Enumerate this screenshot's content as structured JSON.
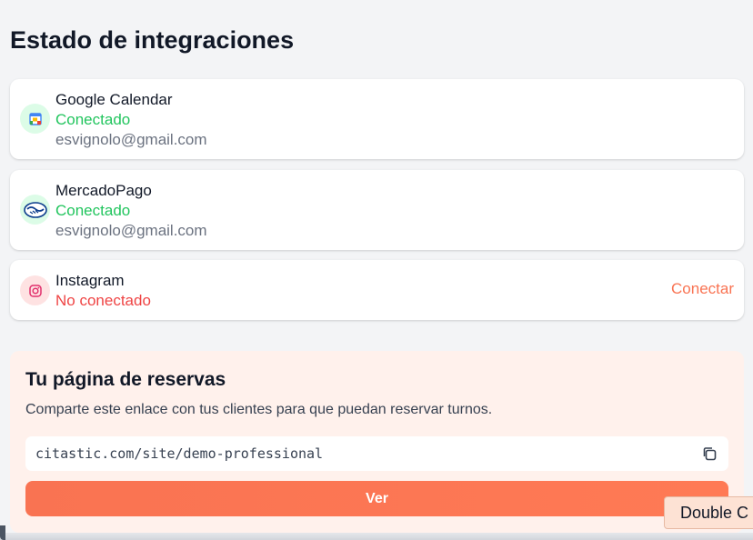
{
  "page": {
    "title": "Estado de integraciones"
  },
  "integrations": [
    {
      "name": "Google Calendar",
      "status": "Conectado",
      "email": "esvignolo@gmail.com",
      "icon": "google-calendar-icon"
    },
    {
      "name": "MercadoPago",
      "status": "Conectado",
      "email": "esvignolo@gmail.com",
      "icon": "mercadopago-icon"
    },
    {
      "name": "Instagram",
      "status": "No conectado",
      "action": "Conectar",
      "icon": "instagram-icon"
    }
  ],
  "booking": {
    "title": "Tu página de reservas",
    "description": "Comparte este enlace con tus clientes para que puedan reservar turnos.",
    "link": "citastic.com/site/demo-professional",
    "copy_icon": "copy-icon",
    "button_label": "Ver"
  },
  "tooltip": {
    "text": "Double C"
  },
  "colors": {
    "connected": "#22c55e",
    "disconnected": "#ef4444",
    "accent": "#f97352",
    "booking_bg": "#fff1ec"
  }
}
